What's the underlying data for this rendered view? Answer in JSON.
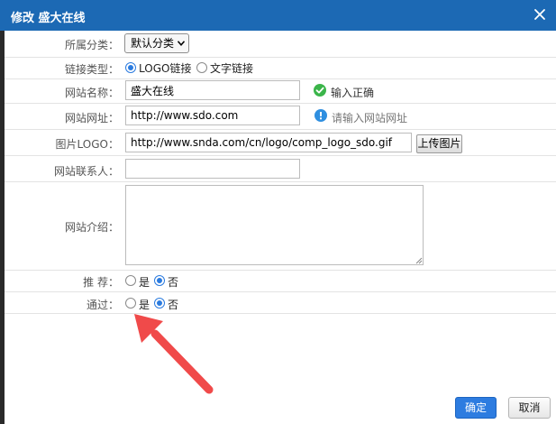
{
  "dialog": {
    "title": "修改 盛大在线",
    "close_icon": "close-icon"
  },
  "form": {
    "category": {
      "label": "所属分类：",
      "value": "默认分类"
    },
    "link_type": {
      "label": "链接类型：",
      "options": [
        "LOGO链接",
        "文字链接"
      ],
      "selected": "LOGO链接"
    },
    "site_name": {
      "label": "网站名称：",
      "value": "盛大在线",
      "hint": "输入正确",
      "hint_icon": "check-circle-icon",
      "hint_color": "#333333"
    },
    "site_url": {
      "label": "网站网址：",
      "value": "http://www.sdo.com",
      "hint": "请输入网站网址",
      "hint_icon": "info-circle-icon",
      "hint_color": "#777777"
    },
    "logo": {
      "label": "图片LOGO：",
      "value": "http://www.snda.com/cn/logo/comp_logo_sdo.gif",
      "upload_label": "上传图片"
    },
    "contact": {
      "label": "网站联系人：",
      "value": ""
    },
    "intro": {
      "label": "网站介绍：",
      "value": ""
    },
    "recommend": {
      "label": "推  荐：",
      "options": [
        "是",
        "否"
      ],
      "selected": "否"
    },
    "approve": {
      "label": "通过：",
      "options": [
        "是",
        "否"
      ],
      "selected": "否"
    }
  },
  "buttons": {
    "ok": "确定",
    "cancel": "取消"
  },
  "colors": {
    "titlebar": "#1c69b4",
    "accent": "#2b7bdf",
    "arrow": "#f04a4a",
    "success": "#3bb54a",
    "info": "#2f8fe0"
  }
}
